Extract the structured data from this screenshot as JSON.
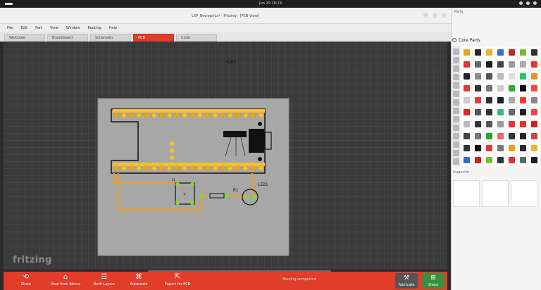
{
  "system": {
    "clock": "Jun 29 19:19"
  },
  "window": {
    "title": "LXP_Review.fzz* - Fritzing - [PCB View]"
  },
  "menu": [
    "File",
    "Edit",
    "Part",
    "View",
    "Window",
    "Routing",
    "Help"
  ],
  "tabs": [
    {
      "label": "Welcome",
      "active": false
    },
    {
      "label": "Breadboard",
      "active": false
    },
    {
      "label": "Schematic",
      "active": false
    },
    {
      "label": "PCB",
      "active": true
    },
    {
      "label": "Code",
      "active": false
    }
  ],
  "canvas": {
    "board_label": "PCB1",
    "resistor_label": "R1",
    "led_label": "LED1",
    "button_label": "S1",
    "logo": "fritzing"
  },
  "toolbar": {
    "buttons": [
      {
        "label": "Share",
        "icon": "share-icon"
      },
      {
        "label": "View from Above",
        "icon": "view-above-icon"
      },
      {
        "label": "Both Layers",
        "icon": "layers-icon"
      },
      {
        "label": "Autoroute",
        "icon": "autoroute-icon"
      },
      {
        "label": "Export for PCB",
        "icon": "export-icon"
      }
    ],
    "status": "Routing completed",
    "fabricate_label": "Fabricate",
    "share_label": "Share"
  },
  "parts": {
    "header": "Parts",
    "search_label": "Core Parts",
    "inspector_header": "Inspector"
  },
  "colors": {
    "accent": "#e23c2a",
    "board": "#a7a7a7",
    "trace": "#f0a020",
    "pad": "#f2c232",
    "pad_green": "#8cd42c",
    "fab_button": "#3c8f3c"
  }
}
